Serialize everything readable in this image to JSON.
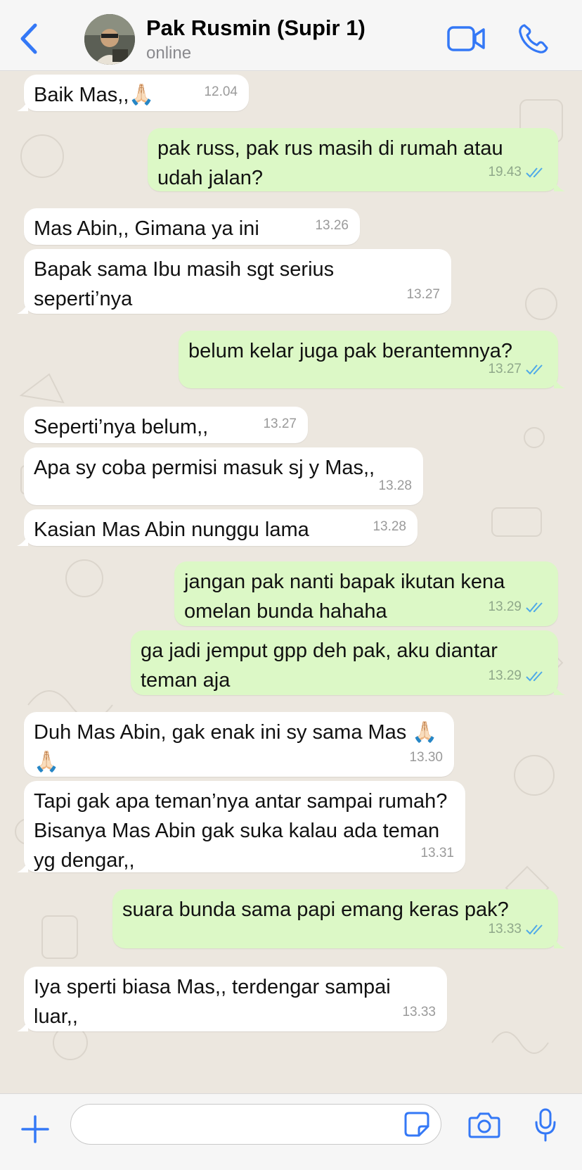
{
  "header": {
    "contact_name": "Pak Rusmin (Supir 1)",
    "status": "online",
    "icons": [
      "back-chevron-icon",
      "video-call-icon",
      "phone-call-icon"
    ]
  },
  "colors": {
    "accent": "#3478f6",
    "outgoing_bubble": "#dcf8c6",
    "incoming_bubble": "#ffffff",
    "chat_background": "#ece7df",
    "read_ticks": "#4fa9e8"
  },
  "messages": [
    {
      "dir": "in",
      "text": "Baik Mas,,🙏🏻",
      "time": "12.04"
    },
    {
      "dir": "out",
      "text": "pak russ, pak rus masih di rumah atau udah jalan?",
      "time": "19.43",
      "read": true
    },
    {
      "dir": "in",
      "text": "Mas Abin,, Gimana ya ini",
      "time": "13.26"
    },
    {
      "dir": "in",
      "text": "Bapak sama Ibu masih sgt serius seperti’nya",
      "time": "13.27"
    },
    {
      "dir": "out",
      "text": "belum kelar juga pak berantemnya?",
      "time": "13.27",
      "read": true
    },
    {
      "dir": "in",
      "text": "Seperti’nya belum,,",
      "time": "13.27"
    },
    {
      "dir": "in",
      "text": "Apa sy coba permisi masuk sj y Mas,,",
      "time": "13.28"
    },
    {
      "dir": "in",
      "text": "Kasian Mas Abin nunggu lama",
      "time": "13.28"
    },
    {
      "dir": "out",
      "text": "jangan pak nanti bapak ikutan kena omelan bunda hahaha",
      "time": "13.29",
      "read": true
    },
    {
      "dir": "out",
      "text": "ga jadi jemput gpp deh pak, aku diantar teman aja",
      "time": "13.29",
      "read": true
    },
    {
      "dir": "in",
      "text": "Duh Mas Abin, gak enak ini sy sama Mas 🙏🏻🙏🏻",
      "time": "13.30"
    },
    {
      "dir": "in",
      "text": "Tapi gak apa teman’nya antar sampai rumah? Bisanya Mas Abin gak suka kalau ada teman yg dengar,,",
      "time": "13.31"
    },
    {
      "dir": "out",
      "text": "suara bunda sama papi emang keras pak?",
      "time": "13.33",
      "read": true
    },
    {
      "dir": "in",
      "text": "Iya sperti biasa Mas,, terdengar sampai luar,,",
      "time": "13.33"
    }
  ],
  "input": {
    "placeholder": "",
    "value": "",
    "icons": [
      "plus-icon",
      "sticker-icon",
      "camera-icon",
      "microphone-icon"
    ]
  }
}
